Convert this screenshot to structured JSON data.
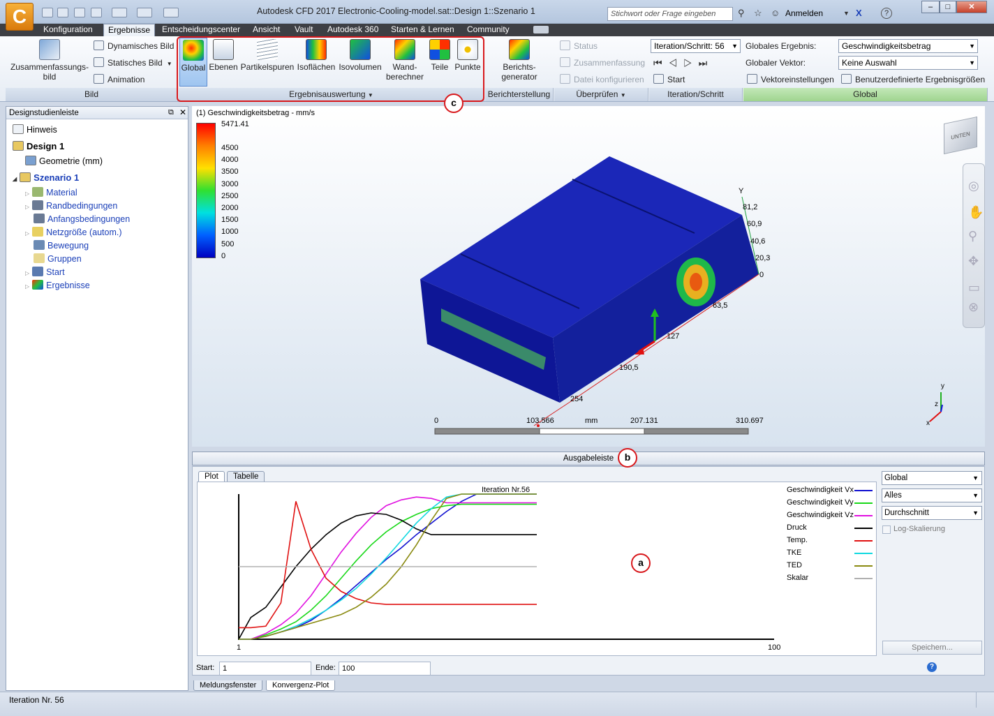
{
  "window": {
    "title": "Autodesk CFD 2017   Electronic-Cooling-model.sat::Design 1::Szenario 1",
    "search_placeholder": "Stichwort oder Frage eingeben",
    "signin": "Anmelden",
    "logo": "C"
  },
  "menu": [
    "Konfiguration",
    "Ergebnisse",
    "Entscheidungscenter",
    "Ansicht",
    "Vault",
    "Autodesk 360",
    "Starten & Lernen",
    "Community"
  ],
  "ribbon": {
    "bild": {
      "summary": "Zusammenfassungs-\nbild",
      "dynamic": "Dynamisches Bild",
      "static": "Statisches Bild",
      "animation": "Animation",
      "group": "Bild"
    },
    "auswertung": {
      "global": "Global",
      "ebenen": "Ebenen",
      "partikel": "Partikelspuren",
      "isoflaechen": "Isoflächen",
      "isovolumen": "Isovolumen",
      "wand": "Wand-\nberechner",
      "teile": "Teile",
      "punkte": "Punkte",
      "group": "Ergebnisauswertung"
    },
    "bericht": {
      "generator": "Berichts-\ngenerator",
      "group": "Berichterstellung"
    },
    "ueberpruefen": {
      "status": "Status",
      "zusammenfassung": "Zusammenfassung",
      "datei": "Datei konfigurieren",
      "group": "Überprüfen"
    },
    "iteration": {
      "combo": "Iteration/Schritt: 56",
      "start": "Start",
      "group": "Iteration/Schritt"
    },
    "global": {
      "result_label": "Globales Ergebnis:",
      "result_value": "Geschwindigkeitsbetrag",
      "vector_label": "Globaler Vektor:",
      "vector_value": "Keine Auswahl",
      "vector_settings": "Vektoreinstellungen",
      "user_results": "Benutzerdefinierte Ergebnisgrößen",
      "group": "Global"
    }
  },
  "design_panel": {
    "title": "Designstudienleiste",
    "items": [
      "Hinweis",
      "Design 1",
      "Geometrie (mm)",
      "Szenario 1",
      "Material",
      "Randbedingungen",
      "Anfangsbedingungen",
      "Netzgröße (autom.)",
      "Bewegung",
      "Gruppen",
      "Start",
      "Ergebnisse"
    ]
  },
  "viewport": {
    "result_title": "(1) Geschwindigkeitsbetrag - mm/s",
    "colorbar_max": "5471.41",
    "colorbar_ticks": [
      "4500",
      "4000",
      "3500",
      "3000",
      "2500",
      "2000",
      "1500",
      "1000",
      "500",
      "0"
    ],
    "axis_y_labels": [
      "Y",
      "81,2",
      "60,9",
      "40,6",
      "20,3",
      "0"
    ],
    "axis_x_labels": [
      "63,5",
      "127",
      "190,5",
      "254"
    ],
    "scale_labels": [
      "0",
      "103.566",
      "mm",
      "207.131",
      "310.697"
    ],
    "viewcube": "UNTEN",
    "triad": [
      "y",
      "z",
      "x"
    ]
  },
  "output": {
    "bar_label": "Ausgabeleiste",
    "tabs": [
      "Plot",
      "Tabelle"
    ],
    "plot_title": "Iteration Nr.56",
    "x_start": "1",
    "x_end": "100",
    "start_label": "Start:",
    "start_value": "1",
    "end_label": "Ende:",
    "end_value": "100",
    "combos": [
      "Global",
      "Alles",
      "Durchschnitt"
    ],
    "log_scale": "Log-Skalierung",
    "save": "Speichern...",
    "bottom_tabs": [
      "Meldungsfenster",
      "Konvergenz-Plot"
    ],
    "callouts": [
      "a",
      "b",
      "c"
    ]
  },
  "chart_data": {
    "type": "line",
    "title": "Iteration Nr.56",
    "x_range": [
      1,
      100
    ],
    "x": [
      1,
      5,
      10,
      15,
      20,
      25,
      30,
      35,
      40,
      45,
      50,
      55,
      60,
      65,
      70,
      75,
      80,
      85,
      90,
      95,
      100
    ],
    "series": [
      {
        "name": "Geschwindigkeit Vx",
        "color": "#1010d0",
        "values": [
          0.0,
          0.0,
          0.02,
          0.05,
          0.08,
          0.13,
          0.2,
          0.28,
          0.37,
          0.46,
          0.55,
          0.63,
          0.72,
          0.8,
          0.88,
          0.95,
          1.0,
          1.0,
          1.0,
          1.0,
          1.0
        ]
      },
      {
        "name": "Geschwindigkeit Vy",
        "color": "#18d818",
        "values": [
          0.0,
          0.0,
          0.03,
          0.07,
          0.12,
          0.2,
          0.3,
          0.42,
          0.54,
          0.65,
          0.74,
          0.81,
          0.86,
          0.9,
          0.92,
          0.93,
          0.93,
          0.93,
          0.93,
          0.93,
          0.93
        ]
      },
      {
        "name": "Geschwindigkeit Vz",
        "color": "#e010e0",
        "values": [
          0.0,
          0.0,
          0.04,
          0.1,
          0.18,
          0.3,
          0.45,
          0.6,
          0.73,
          0.84,
          0.92,
          0.96,
          0.98,
          0.97,
          0.94,
          0.94,
          0.94,
          0.94,
          0.94,
          0.94,
          0.94
        ]
      },
      {
        "name": "Druck",
        "color": "#000000",
        "values": [
          0.0,
          0.15,
          0.22,
          0.36,
          0.5,
          0.62,
          0.72,
          0.8,
          0.85,
          0.87,
          0.86,
          0.82,
          0.76,
          0.72,
          0.72,
          0.72,
          0.72,
          0.72,
          0.72,
          0.72,
          0.72
        ]
      },
      {
        "name": "Temp.",
        "color": "#e01010",
        "values": [
          0.08,
          0.08,
          0.09,
          0.25,
          0.95,
          0.62,
          0.42,
          0.33,
          0.28,
          0.25,
          0.24,
          0.24,
          0.24,
          0.24,
          0.24,
          0.24,
          0.24,
          0.24,
          0.24,
          0.24,
          0.24
        ]
      },
      {
        "name": "TKE",
        "color": "#10d8e0",
        "values": [
          0.0,
          0.0,
          0.02,
          0.05,
          0.09,
          0.14,
          0.2,
          0.27,
          0.35,
          0.45,
          0.56,
          0.68,
          0.8,
          0.9,
          0.98,
          1.0,
          1.0,
          1.0,
          1.0,
          1.0,
          1.0
        ]
      },
      {
        "name": "TED",
        "color": "#8a8a10",
        "values": [
          0.0,
          0.0,
          0.02,
          0.05,
          0.08,
          0.11,
          0.14,
          0.17,
          0.22,
          0.29,
          0.38,
          0.5,
          0.65,
          0.82,
          0.97,
          1.0,
          1.0,
          1.0,
          1.0,
          1.0,
          1.0
        ]
      },
      {
        "name": "Skalar",
        "color": "#b0b0b0",
        "values": [
          0.5,
          0.5,
          0.5,
          0.5,
          0.5,
          0.5,
          0.5,
          0.5,
          0.5,
          0.5,
          0.5,
          0.5,
          0.5,
          0.5,
          0.5,
          0.5,
          0.5,
          0.5,
          0.5,
          0.5,
          0.5
        ]
      }
    ]
  },
  "status": {
    "text": "Iteration Nr. 56"
  }
}
